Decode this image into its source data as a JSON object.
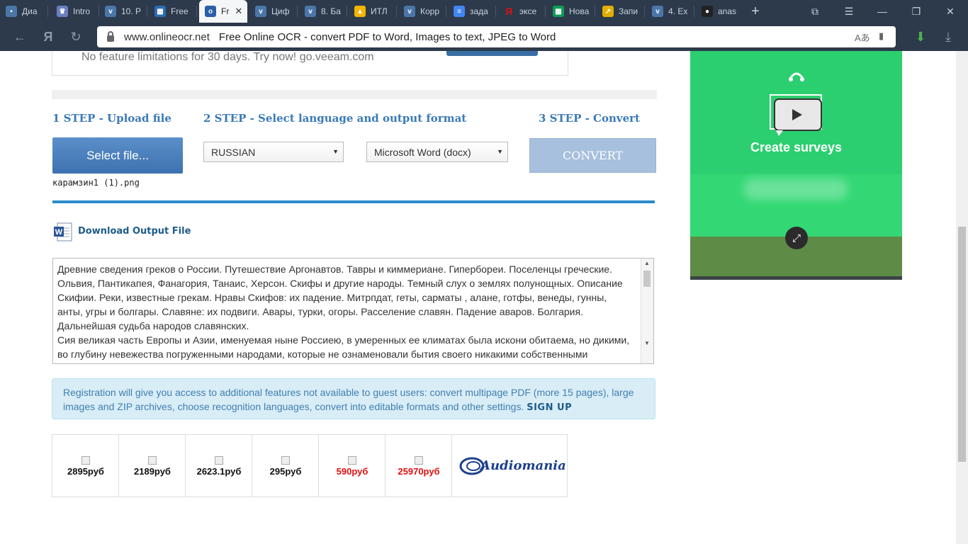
{
  "browser": {
    "tabs": [
      {
        "label": "Диа",
        "icon": "chat-icon",
        "color": "#4a76a8"
      },
      {
        "label": "Intro",
        "icon": "crown-icon",
        "color": "#6a7fbf"
      },
      {
        "label": "10. Р",
        "icon": "vk-icon",
        "color": "#4a76a8"
      },
      {
        "label": "Free",
        "icon": "grid-icon",
        "color": "#2b6cb0"
      },
      {
        "label": "Fr",
        "icon": "onlineocr-icon",
        "color": "#2a5fa8",
        "active": true
      },
      {
        "label": "Циф",
        "icon": "vk-icon",
        "color": "#4a76a8"
      },
      {
        "label": "8. Ба",
        "icon": "vk-icon",
        "color": "#4a76a8"
      },
      {
        "label": "ИТЛ",
        "icon": "drive-icon",
        "color": "#f4b400"
      },
      {
        "label": "Корр",
        "icon": "vk-icon",
        "color": "#4a76a8"
      },
      {
        "label": "зада",
        "icon": "docs-icon",
        "color": "#4285f4"
      },
      {
        "label": "эксе",
        "icon": "yandex-icon",
        "color": "#e01010"
      },
      {
        "label": "Нова",
        "icon": "sheets-icon",
        "color": "#0f9d58"
      },
      {
        "label": "Запи",
        "icon": "chart-icon",
        "color": "#e0b000"
      },
      {
        "label": "4. Ex",
        "icon": "vk-icon",
        "color": "#4a76a8"
      },
      {
        "label": "anas",
        "icon": "github-icon",
        "color": "#222222"
      }
    ],
    "new_tab": "+",
    "address": {
      "domain": "www.onlineocr.net",
      "title": "Free Online OCR - convert PDF to Word, Images to text, JPEG to Word"
    },
    "nav": {
      "back": "←",
      "yandex": "Я",
      "reload": "↻"
    }
  },
  "promo": {
    "text": "No feature limitations for 30 days. Try now! go.veeam.com"
  },
  "steps": {
    "step1": "1 STEP - Upload file",
    "step2": "2 STEP - Select language and output format",
    "step3": "3 STEP - Convert"
  },
  "upload": {
    "button_label": "Select file...",
    "filename": "карамзин1 (1).png"
  },
  "language_select": {
    "value": "RUSSIAN"
  },
  "format_select": {
    "value": "Microsoft Word (docx)"
  },
  "convert": {
    "label": "CONVERT"
  },
  "download": {
    "label": "Download Output File"
  },
  "ocr_text": {
    "value": "Древние сведения греков о России. Путешествие Аргонавтов. Тавры и киммериане. Гипербореи. Поселенцы греческие. Ольвия, Пантикапея, Фанагория, Танаис, Херсон. Скифы и другие народы. Темный слух о землях полунощных. Описание Скифии. Реки, известные грекам. Нравы Скифов: их падение. Митрпдат, геты, сарматы , алане, готфы, венеды, гунны, анты, угры и болгары. Славяне: их подвиги. Авары, турки, огоры. Расселение славян. Падение аваров. Болгария. Дальнейшая судьба народов славянских.\nСия великая часть Европы и Азии, именуемая ныне Россиею, в умеренных ее климатах была искони обитаема, но дикими, во глубину невежества погруженными народами, которые не ознаменовали бытия своего никакими собственными"
  },
  "notice": {
    "text": "Registration will give you access to additional features not available to guest users: convert multipage PDF (more 15 pages), large images and ZIP archives, choose recognition languages, convert into editable formats and other settings.",
    "signup": "SIGN UP"
  },
  "products": [
    {
      "price": "2895руб",
      "color": "#111111"
    },
    {
      "price": "2189руб",
      "color": "#111111"
    },
    {
      "price": "2623.1руб",
      "color": "#111111"
    },
    {
      "price": "295руб",
      "color": "#111111"
    },
    {
      "price": "590руб",
      "color": "#e01010"
    },
    {
      "price": "25970руб",
      "color": "#e01010"
    }
  ],
  "audiomania": {
    "logo_text": "Audiomania"
  },
  "ad": {
    "title": "Create surveys",
    "background": "#2ccf6f"
  }
}
